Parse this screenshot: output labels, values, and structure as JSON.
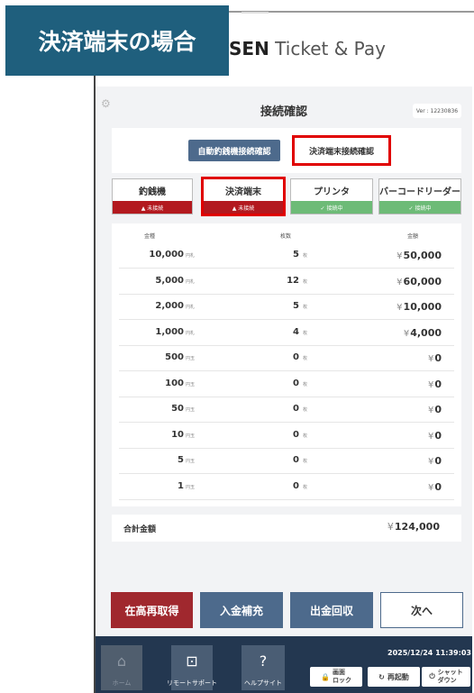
{
  "label": "決済端末の場合",
  "brand": {
    "prefix": "SEN",
    "suffix": " Ticket & Pay"
  },
  "title": "接続確認",
  "version": "Ver : 12230836",
  "tabs": {
    "auto": "自動釣銭機接続確認",
    "terminal": "決済端末接続確認"
  },
  "devices": [
    {
      "name": "釣銭機",
      "status": "▲ 未接続",
      "state": "bad"
    },
    {
      "name": "決済端末",
      "status": "▲ 未接続",
      "state": "bad"
    },
    {
      "name": "プリンタ",
      "status": "✓ 接続中",
      "state": "ok"
    },
    {
      "name": "バーコードリーダー",
      "status": "✓ 接続中",
      "state": "ok"
    }
  ],
  "table": {
    "headers": [
      "金種",
      "枚数",
      "金額"
    ],
    "rows": [
      {
        "denom": "10,000",
        "unit": "円札",
        "count": "5",
        "cunit": "枚",
        "amount": "50,000"
      },
      {
        "denom": "5,000",
        "unit": "円札",
        "count": "12",
        "cunit": "枚",
        "amount": "60,000"
      },
      {
        "denom": "2,000",
        "unit": "円札",
        "count": "5",
        "cunit": "枚",
        "amount": "10,000"
      },
      {
        "denom": "1,000",
        "unit": "円札",
        "count": "4",
        "cunit": "枚",
        "amount": "4,000"
      },
      {
        "denom": "500",
        "unit": "円玉",
        "count": "0",
        "cunit": "枚",
        "amount": "0"
      },
      {
        "denom": "100",
        "unit": "円玉",
        "count": "0",
        "cunit": "枚",
        "amount": "0"
      },
      {
        "denom": "50",
        "unit": "円玉",
        "count": "0",
        "cunit": "枚",
        "amount": "0"
      },
      {
        "denom": "10",
        "unit": "円玉",
        "count": "0",
        "cunit": "枚",
        "amount": "0"
      },
      {
        "denom": "5",
        "unit": "円玉",
        "count": "0",
        "cunit": "枚",
        "amount": "0"
      },
      {
        "denom": "1",
        "unit": "円玉",
        "count": "0",
        "cunit": "枚",
        "amount": "0"
      }
    ],
    "yen": "¥"
  },
  "total": {
    "label": "合計金額",
    "value": "124,000"
  },
  "actions": {
    "restock": "在高再取得",
    "deposit": "入金補充",
    "withdraw": "出金回収",
    "next": "次へ"
  },
  "nav": {
    "home": "ホーム",
    "remote": "リモートサポート",
    "help": "ヘルプサイト"
  },
  "datetime": "2025/12/24 11:39:03",
  "mini": {
    "lock": "画面\nロック",
    "restart": "再起動",
    "shutdown": "シャット\nダウン"
  },
  "colors": {
    "label_bg": "#1f5f7d",
    "highlight": "#e00000",
    "restock_btn": "#a0282e",
    "blue_btn": "#4d6a8c",
    "footer": "#233750"
  }
}
